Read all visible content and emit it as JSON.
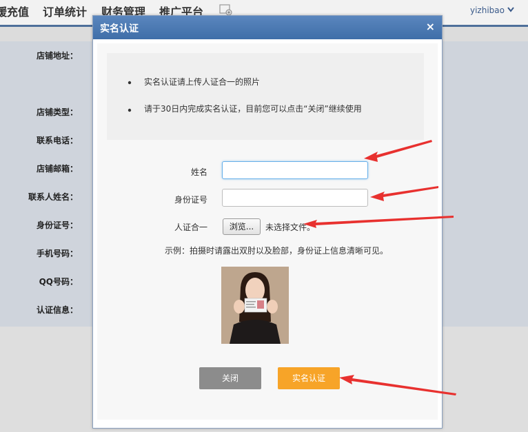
{
  "nav": {
    "items": [
      "缓充值",
      "订单统计",
      "财务管理",
      "推广平台"
    ],
    "user": "yizhibao"
  },
  "background_form": {
    "labels": [
      "店铺地址：",
      "店铺类型：",
      "联系电话：",
      "店铺邮箱：",
      "联系人姓名：",
      "身份证号：",
      "手机号码：",
      "QQ号码：",
      "认证信息："
    ]
  },
  "modal": {
    "title": "实名认证",
    "close_symbol": "×",
    "notices": [
      "实名认证请上传人证合一的照片",
      "请于30日内完成实名认证，目前您可以点击“关闭”继续使用"
    ],
    "form": {
      "name_label": "姓名",
      "name_value": "",
      "id_label": "身份证号",
      "id_value": "",
      "photo_label": "人证合一",
      "browse_label": "浏览...",
      "file_status": "未选择文件。",
      "example": "示例：拍摄时请露出双肘以及脸部，身份证上信息清晰可见。"
    },
    "buttons": {
      "close": "关闭",
      "verify": "实名认证"
    }
  },
  "colors": {
    "header": "#4a78b2",
    "close_button": "#8c8c8c",
    "verify_button": "#f7a428",
    "arrow": "#e8312f"
  }
}
